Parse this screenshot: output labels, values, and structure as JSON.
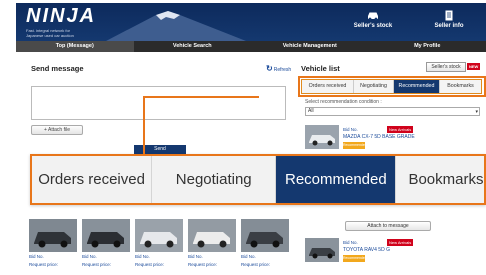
{
  "header": {
    "logo": "NINJA",
    "tagline": "Fast. integral network for Japanese used car auction",
    "seller_stock": "Seller's stock",
    "seller_info": "Seller info"
  },
  "nav": [
    {
      "label": "Top (Message)",
      "active": true
    },
    {
      "label": "Vehicle Search",
      "active": false
    },
    {
      "label": "Vehicle Management",
      "active": false
    },
    {
      "label": "My Profile",
      "active": false
    }
  ],
  "send_message": {
    "title": "Send message",
    "attach_file": "+ Attach file",
    "send": "Send",
    "refresh": "Refresh"
  },
  "vehicle_list": {
    "title": "Vehicle list",
    "seller_stock_button": "Seller's stock",
    "new_badge": "NEW",
    "tabs": [
      {
        "label": "Orders received",
        "active": false
      },
      {
        "label": "Negotiating",
        "active": false
      },
      {
        "label": "Recommended",
        "active": true
      },
      {
        "label": "Bookmarks",
        "active": false
      }
    ],
    "condition_label": "Select recommendation condition :",
    "condition_value": "All",
    "cars": [
      {
        "bid_no": "Bid No.",
        "badge": "New Arrivals",
        "name": "MAZDA  CX-7 5D  BASE GRADE",
        "tag": "Recommended"
      },
      {
        "bid_no": "Bid No.",
        "badge": "New Arrivals",
        "name": "TOYOTA  RAV4 5D  G",
        "tag": "Recommended"
      }
    ],
    "attach_to_message": "Attach to message"
  },
  "grid": [
    {
      "bid_no": "Bid No.",
      "price": "Request price:"
    },
    {
      "bid_no": "Bid No.",
      "price": "Request price:"
    },
    {
      "bid_no": "Bid No.",
      "price": "Request price:"
    },
    {
      "bid_no": "Bid No.",
      "price": "Request price:"
    },
    {
      "bid_no": "Bid No.",
      "price": "Request price:"
    }
  ],
  "callout_tabs": [
    {
      "label": "Orders received",
      "active": false
    },
    {
      "label": "Negotiating",
      "active": false
    },
    {
      "label": "Recommended",
      "active": true
    },
    {
      "label": "Bookmarks",
      "active": false
    }
  ],
  "colors": {
    "brand_navy": "#14386f",
    "accent_orange": "#e8761a",
    "new_red": "#d0021b",
    "recommended_tag": "#f2a81d"
  }
}
